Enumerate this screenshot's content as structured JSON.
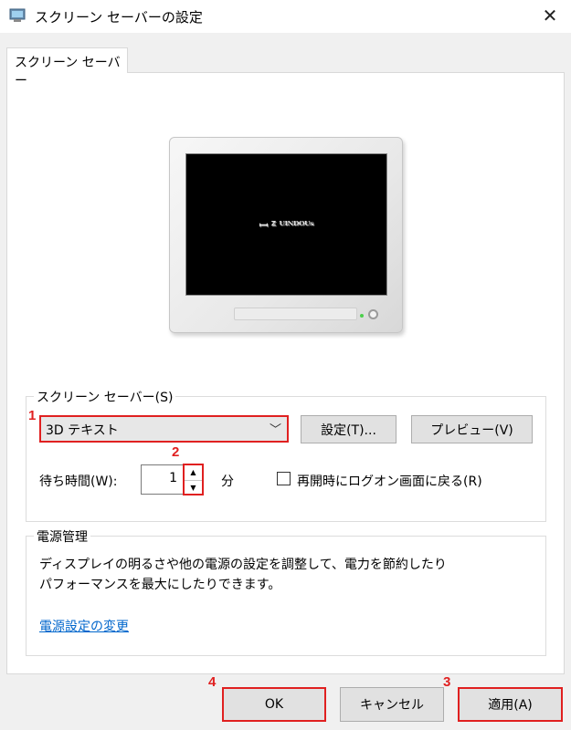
{
  "window": {
    "title": "スクリーン セーバーの設定",
    "close_glyph": "✕"
  },
  "tab": {
    "label": "スクリーン セーバー"
  },
  "preview": {
    "screen_text": "ꟷ ᙆ  ᵂᴵᴺᴰᴼᵂˢ"
  },
  "screensaver_group": {
    "label": "スクリーン セーバー(S)",
    "selected": "3D テキスト",
    "settings_button": "設定(T)...",
    "preview_button": "プレビュー(V)",
    "wait_label": "待ち時間(W):",
    "wait_value": "1",
    "wait_unit": "分",
    "logon_checkbox_label": "再開時にログオン画面に戻る(R)",
    "logon_checked": false
  },
  "power_group": {
    "label": "電源管理",
    "description_line1": "ディスプレイの明るさや他の電源の設定を調整して、電力を節約したり",
    "description_line2": "パフォーマンスを最大にしたりできます。",
    "link": "電源設定の変更"
  },
  "footer": {
    "ok": "OK",
    "cancel": "キャンセル",
    "apply": "適用(A)"
  },
  "markers": {
    "m1": "1",
    "m2": "2",
    "m3": "3",
    "m4": "4"
  },
  "colors": {
    "highlight": "#e02020",
    "link": "#0066cc"
  }
}
